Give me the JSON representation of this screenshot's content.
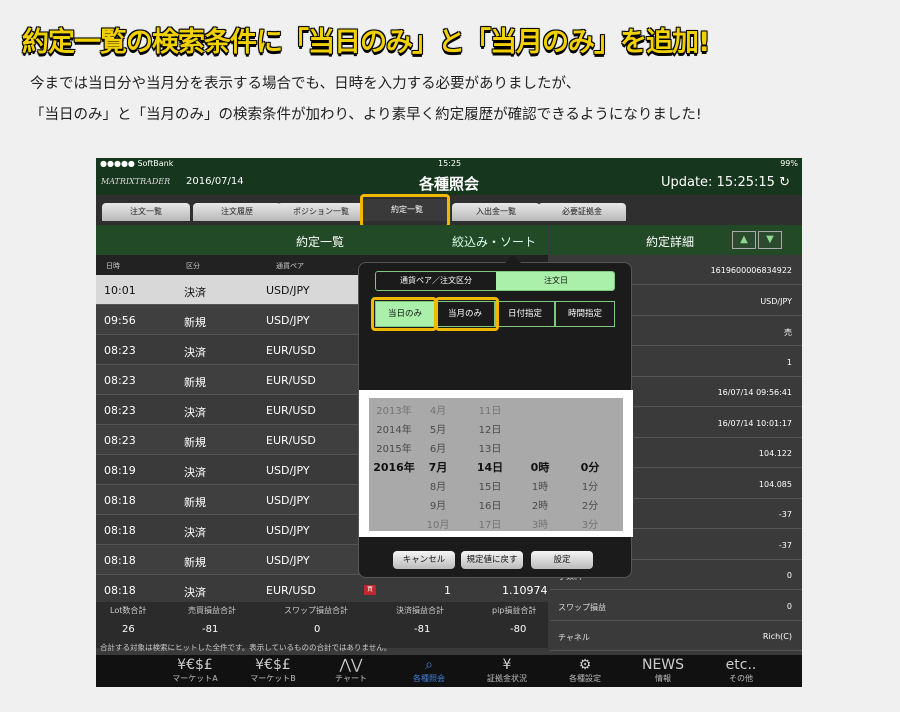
{
  "headline": "約定一覧の検索条件に「当日のみ」と「当月のみ」を追加!",
  "description": [
    "今までは当日分や当月分を表示する場合でも、日時を入力する必要がありましたが、",
    "「当日のみ」と「当月のみ」の検索条件が加わり、より素早く約定履歴が確認できるようになりました!"
  ],
  "status": {
    "carrier": "●●●●● SoftBank",
    "time": "15:25",
    "battery": "99%"
  },
  "header": {
    "logo": "MATRIXTRADER",
    "date": "2016/07/14",
    "title": "各種照会",
    "update": "Update: 15:25:15",
    "refresh_icon": "↻"
  },
  "tabs": [
    {
      "label": "注文一覧"
    },
    {
      "label": "注文履歴"
    },
    {
      "label": "ポジション一覧"
    },
    {
      "label": "約定一覧"
    },
    {
      "label": "入出金一覧"
    },
    {
      "label": "必要証拠金"
    }
  ],
  "list": {
    "title": "約定一覧",
    "filter_label": "絞込み・ソート",
    "columns": [
      "日時",
      "区分",
      "通貨ペア"
    ],
    "rows": [
      {
        "time": "10:01",
        "type": "決済",
        "pair": "USD/JPY"
      },
      {
        "time": "09:56",
        "type": "新規",
        "pair": "USD/JPY"
      },
      {
        "time": "08:23",
        "type": "決済",
        "pair": "EUR/USD"
      },
      {
        "time": "08:23",
        "type": "新規",
        "pair": "EUR/USD"
      },
      {
        "time": "08:23",
        "type": "決済",
        "pair": "EUR/USD"
      },
      {
        "time": "08:23",
        "type": "新規",
        "pair": "EUR/USD"
      },
      {
        "time": "08:19",
        "type": "決済",
        "pair": "USD/JPY"
      },
      {
        "time": "08:18",
        "type": "新規",
        "pair": "USD/JPY"
      },
      {
        "time": "08:18",
        "type": "決済",
        "pair": "USD/JPY"
      },
      {
        "time": "08:18",
        "type": "新規",
        "pair": "USD/JPY"
      },
      {
        "time": "08:18",
        "type": "決済",
        "pair": "EUR/USD",
        "badge": "買",
        "qty": "1",
        "price": "1.10974"
      }
    ]
  },
  "summary": {
    "headers": [
      "Lot数合計",
      "売買損益合計",
      "スワップ損益合計",
      "決済損益合計",
      "pip損益合計"
    ],
    "values": [
      "26",
      "-81",
      "0",
      "-81",
      "-80"
    ],
    "note": "合計する対象は検索にヒットした全件です。表示しているものの合計ではありません。"
  },
  "detail": {
    "title": "約定詳細",
    "up_icon": "▲",
    "down_icon": "▼",
    "rows": [
      {
        "label": "",
        "value": "1619600006834922"
      },
      {
        "label": "",
        "value": "USD/JPY"
      },
      {
        "label": "",
        "value": "売"
      },
      {
        "label": "",
        "value": "1"
      },
      {
        "label": "",
        "value": "16/07/14 09:56:41"
      },
      {
        "label": "",
        "value": "16/07/14 10:01:17"
      },
      {
        "label": "",
        "value": "104.122"
      },
      {
        "label": "",
        "value": "104.085"
      },
      {
        "label": "",
        "value": "-37"
      },
      {
        "label": "",
        "value": "-37"
      },
      {
        "label": "手数料",
        "value": "0"
      },
      {
        "label": "スワップ損益",
        "value": "0"
      },
      {
        "label": "チャネル",
        "value": "Rich(C)"
      }
    ]
  },
  "popup": {
    "seg": [
      "通貨ペア／注文区分",
      "注文日"
    ],
    "buttons": [
      "当日のみ",
      "当月のみ",
      "日付指定",
      "時間指定"
    ],
    "picker": {
      "years": [
        "2013年",
        "2014年",
        "2015年",
        "2016年"
      ],
      "months": [
        "4月",
        "5月",
        "6月",
        "7月",
        "8月",
        "9月",
        "10月"
      ],
      "days": [
        "11日",
        "12日",
        "13日",
        "14日",
        "15日",
        "16日",
        "17日"
      ],
      "hours": [
        "0時",
        "1時",
        "2時",
        "3時"
      ],
      "mins": [
        "0分",
        "1分",
        "2分",
        "3分"
      ]
    },
    "actions": [
      "キャンセル",
      "規定値に戻す",
      "設定"
    ]
  },
  "bottom": [
    {
      "icon": "¥€$£",
      "label": "マーケットA"
    },
    {
      "icon": "¥€$£",
      "label": "マーケットB"
    },
    {
      "icon": "⋀⋁",
      "label": "チャート"
    },
    {
      "icon": "⌕",
      "label": "各種照会"
    },
    {
      "icon": "¥",
      "label": "証拠金状況"
    },
    {
      "icon": "⚙",
      "label": "各種設定"
    },
    {
      "icon": "NEWS",
      "label": "情報"
    },
    {
      "icon": "etc..",
      "label": "その他"
    }
  ],
  "colors": {
    "accent": "#f2b800",
    "header_green": "#16361d",
    "section_green": "#234a26",
    "segment_green": "#aaf0aa"
  }
}
